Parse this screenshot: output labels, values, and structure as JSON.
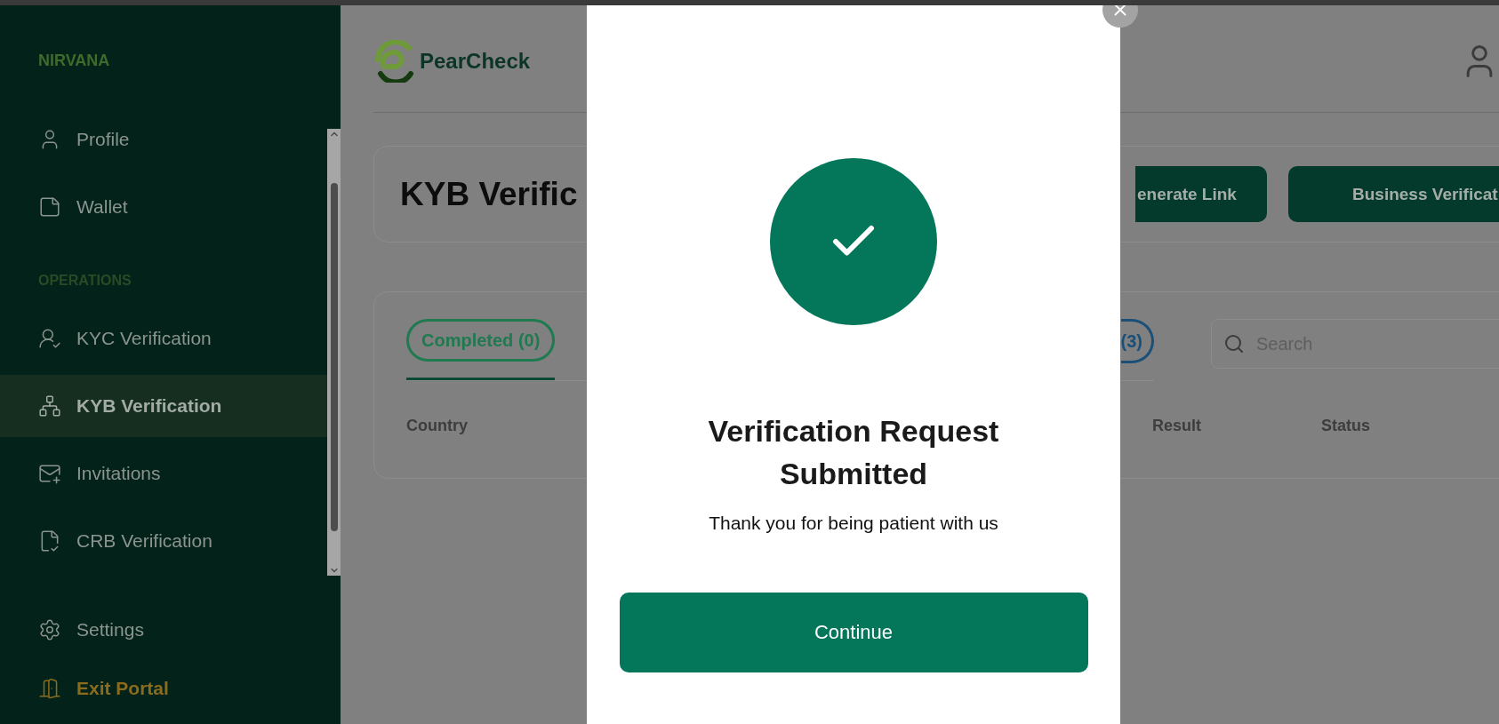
{
  "sidebar": {
    "brand": "NIRVANA",
    "sections": [
      {
        "items": [
          {
            "label": "Profile",
            "selected": false
          },
          {
            "label": "Wallet",
            "selected": false
          }
        ]
      },
      {
        "heading": "OPERATIONS",
        "items": [
          {
            "label": "KYC Verification",
            "selected": false
          },
          {
            "label": "KYB Verification",
            "selected": true
          },
          {
            "label": "Invitations",
            "selected": false
          },
          {
            "label": "CRB Verification",
            "selected": false
          }
        ]
      }
    ],
    "footer": [
      {
        "label": "Settings",
        "kind": "link"
      },
      {
        "label": "Exit Portal",
        "kind": "exit"
      }
    ]
  },
  "main": {
    "logo": "PearCheck",
    "page_title": "KYB Verific",
    "actions": [
      "enerate Link",
      "Business Verificat"
    ],
    "tabs": [
      {
        "label": "Completed (0)",
        "selected": true,
        "color": "#1f7a50"
      },
      {
        "label": "(3)",
        "selected": false,
        "color": "#1a4f78"
      }
    ],
    "search": {
      "placeholder": "Search"
    },
    "columns": [
      "Country",
      "Result",
      "Status"
    ]
  },
  "modal": {
    "title": "Verification Request Submitted",
    "message": "Thank you for being patient with us",
    "button": "Continue"
  }
}
